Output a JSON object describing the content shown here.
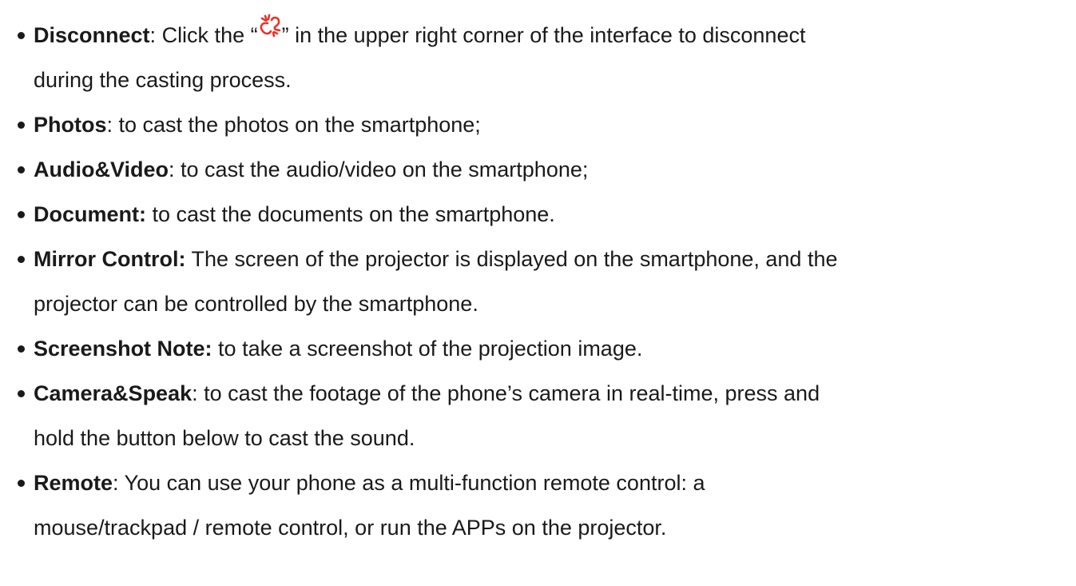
{
  "items": [
    {
      "term": "Disconnect",
      "sep": ":",
      "pre": " Click the “",
      "icon": "broken-link-icon",
      "post": "” in the upper right corner of the interface to disconnect",
      "cont": "during the casting process."
    },
    {
      "term": "Photos",
      "sep": ":",
      "text": " to cast the photos on the smartphone;"
    },
    {
      "term": "Audio&Video",
      "sep": ":",
      "text": " to cast the audio/video on the smartphone;"
    },
    {
      "term": "Document:",
      "sep": "",
      "text": " to cast the documents on the smartphone."
    },
    {
      "term": "Mirror Control:",
      "sep": "",
      "text": " The screen of the projector is displayed on the smartphone, and the",
      "cont": "projector can be controlled by the smartphone."
    },
    {
      "term": "Screenshot Note:",
      "sep": "",
      "text": " to take a screenshot of the projection image."
    },
    {
      "term": "Camera&Speak",
      "sep": ":",
      "text": " to cast the footage of the phone’s camera in real-time, press and",
      "cont": "hold the button below to cast the sound."
    },
    {
      "term": "Remote",
      "sep": ":",
      "text": " You can use your phone as a multi-function remote control: a",
      "cont": "mouse/trackpad / remote control, or run the APPs on the projector."
    }
  ],
  "colors": {
    "text": "#1a1a1a",
    "icon": "#e8332a"
  }
}
